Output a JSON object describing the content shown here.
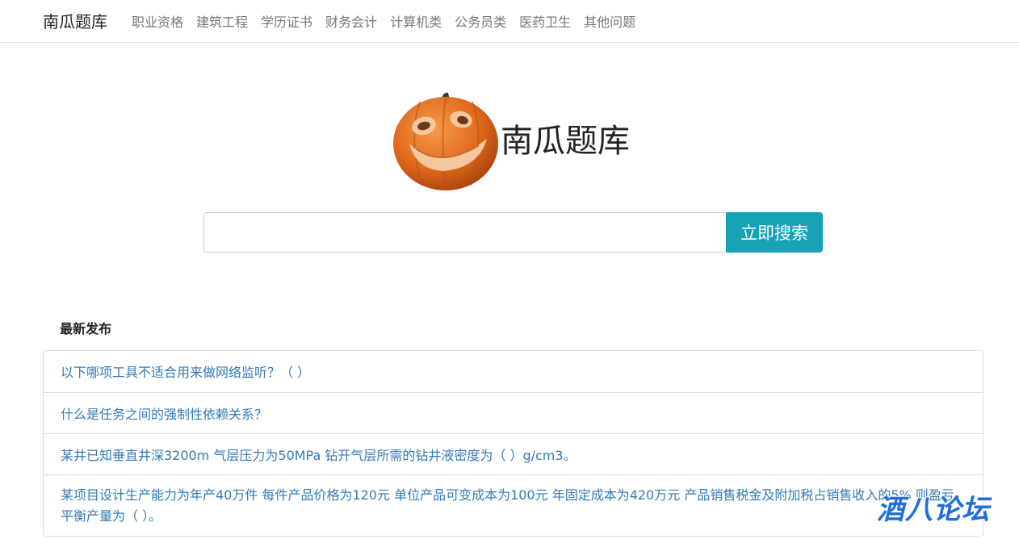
{
  "navbar": {
    "brand": "南瓜题库",
    "items": [
      {
        "label": "职业资格"
      },
      {
        "label": "建筑工程"
      },
      {
        "label": "学历证书"
      },
      {
        "label": "财务会计"
      },
      {
        "label": "计算机类"
      },
      {
        "label": "公务员类"
      },
      {
        "label": "医药卫生"
      },
      {
        "label": "其他问题"
      }
    ]
  },
  "hero": {
    "title": "南瓜题库",
    "logo_icon": "pumpkin-icon"
  },
  "search": {
    "value": "",
    "placeholder": "",
    "button_label": "立即搜索",
    "button_color": "#17a2b8"
  },
  "latest": {
    "title": "最新发布",
    "items": [
      {
        "text": "以下哪项工具不适合用来做网络监听？（ ）"
      },
      {
        "text": "什么是任务之间的强制性依赖关系？"
      },
      {
        "text": "某井已知垂直井深3200m 气层压力为50MPa 钻开气层所需的钻井液密度为（ ）g/cm3。"
      },
      {
        "text": "某项目设计生产能力为年产40万件 每件产品价格为120元 单位产品可变成本为100元 年固定成本为420万元 产品销售税金及附加税占销售收入的5% 则盈亏平衡产量为（ ）。"
      }
    ],
    "link_color": "#337ab7"
  },
  "watermark": {
    "text": "酒八论坛"
  }
}
